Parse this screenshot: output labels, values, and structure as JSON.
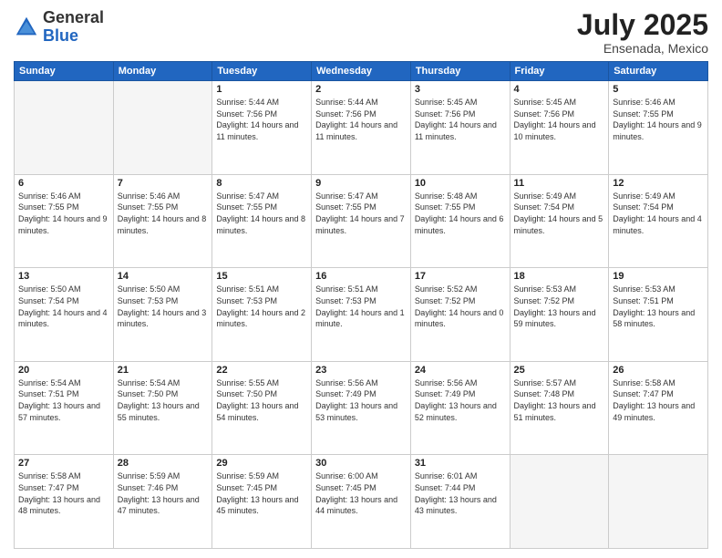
{
  "header": {
    "logo_general": "General",
    "logo_blue": "Blue",
    "month": "July 2025",
    "location": "Ensenada, Mexico"
  },
  "weekdays": [
    "Sunday",
    "Monday",
    "Tuesday",
    "Wednesday",
    "Thursday",
    "Friday",
    "Saturday"
  ],
  "weeks": [
    [
      {
        "day": "",
        "empty": true
      },
      {
        "day": "",
        "empty": true
      },
      {
        "day": "1",
        "sunrise": "Sunrise: 5:44 AM",
        "sunset": "Sunset: 7:56 PM",
        "daylight": "Daylight: 14 hours and 11 minutes."
      },
      {
        "day": "2",
        "sunrise": "Sunrise: 5:44 AM",
        "sunset": "Sunset: 7:56 PM",
        "daylight": "Daylight: 14 hours and 11 minutes."
      },
      {
        "day": "3",
        "sunrise": "Sunrise: 5:45 AM",
        "sunset": "Sunset: 7:56 PM",
        "daylight": "Daylight: 14 hours and 11 minutes."
      },
      {
        "day": "4",
        "sunrise": "Sunrise: 5:45 AM",
        "sunset": "Sunset: 7:56 PM",
        "daylight": "Daylight: 14 hours and 10 minutes."
      },
      {
        "day": "5",
        "sunrise": "Sunrise: 5:46 AM",
        "sunset": "Sunset: 7:55 PM",
        "daylight": "Daylight: 14 hours and 9 minutes."
      }
    ],
    [
      {
        "day": "6",
        "sunrise": "Sunrise: 5:46 AM",
        "sunset": "Sunset: 7:55 PM",
        "daylight": "Daylight: 14 hours and 9 minutes."
      },
      {
        "day": "7",
        "sunrise": "Sunrise: 5:46 AM",
        "sunset": "Sunset: 7:55 PM",
        "daylight": "Daylight: 14 hours and 8 minutes."
      },
      {
        "day": "8",
        "sunrise": "Sunrise: 5:47 AM",
        "sunset": "Sunset: 7:55 PM",
        "daylight": "Daylight: 14 hours and 8 minutes."
      },
      {
        "day": "9",
        "sunrise": "Sunrise: 5:47 AM",
        "sunset": "Sunset: 7:55 PM",
        "daylight": "Daylight: 14 hours and 7 minutes."
      },
      {
        "day": "10",
        "sunrise": "Sunrise: 5:48 AM",
        "sunset": "Sunset: 7:55 PM",
        "daylight": "Daylight: 14 hours and 6 minutes."
      },
      {
        "day": "11",
        "sunrise": "Sunrise: 5:49 AM",
        "sunset": "Sunset: 7:54 PM",
        "daylight": "Daylight: 14 hours and 5 minutes."
      },
      {
        "day": "12",
        "sunrise": "Sunrise: 5:49 AM",
        "sunset": "Sunset: 7:54 PM",
        "daylight": "Daylight: 14 hours and 4 minutes."
      }
    ],
    [
      {
        "day": "13",
        "sunrise": "Sunrise: 5:50 AM",
        "sunset": "Sunset: 7:54 PM",
        "daylight": "Daylight: 14 hours and 4 minutes."
      },
      {
        "day": "14",
        "sunrise": "Sunrise: 5:50 AM",
        "sunset": "Sunset: 7:53 PM",
        "daylight": "Daylight: 14 hours and 3 minutes."
      },
      {
        "day": "15",
        "sunrise": "Sunrise: 5:51 AM",
        "sunset": "Sunset: 7:53 PM",
        "daylight": "Daylight: 14 hours and 2 minutes."
      },
      {
        "day": "16",
        "sunrise": "Sunrise: 5:51 AM",
        "sunset": "Sunset: 7:53 PM",
        "daylight": "Daylight: 14 hours and 1 minute."
      },
      {
        "day": "17",
        "sunrise": "Sunrise: 5:52 AM",
        "sunset": "Sunset: 7:52 PM",
        "daylight": "Daylight: 14 hours and 0 minutes."
      },
      {
        "day": "18",
        "sunrise": "Sunrise: 5:53 AM",
        "sunset": "Sunset: 7:52 PM",
        "daylight": "Daylight: 13 hours and 59 minutes."
      },
      {
        "day": "19",
        "sunrise": "Sunrise: 5:53 AM",
        "sunset": "Sunset: 7:51 PM",
        "daylight": "Daylight: 13 hours and 58 minutes."
      }
    ],
    [
      {
        "day": "20",
        "sunrise": "Sunrise: 5:54 AM",
        "sunset": "Sunset: 7:51 PM",
        "daylight": "Daylight: 13 hours and 57 minutes."
      },
      {
        "day": "21",
        "sunrise": "Sunrise: 5:54 AM",
        "sunset": "Sunset: 7:50 PM",
        "daylight": "Daylight: 13 hours and 55 minutes."
      },
      {
        "day": "22",
        "sunrise": "Sunrise: 5:55 AM",
        "sunset": "Sunset: 7:50 PM",
        "daylight": "Daylight: 13 hours and 54 minutes."
      },
      {
        "day": "23",
        "sunrise": "Sunrise: 5:56 AM",
        "sunset": "Sunset: 7:49 PM",
        "daylight": "Daylight: 13 hours and 53 minutes."
      },
      {
        "day": "24",
        "sunrise": "Sunrise: 5:56 AM",
        "sunset": "Sunset: 7:49 PM",
        "daylight": "Daylight: 13 hours and 52 minutes."
      },
      {
        "day": "25",
        "sunrise": "Sunrise: 5:57 AM",
        "sunset": "Sunset: 7:48 PM",
        "daylight": "Daylight: 13 hours and 51 minutes."
      },
      {
        "day": "26",
        "sunrise": "Sunrise: 5:58 AM",
        "sunset": "Sunset: 7:47 PM",
        "daylight": "Daylight: 13 hours and 49 minutes."
      }
    ],
    [
      {
        "day": "27",
        "sunrise": "Sunrise: 5:58 AM",
        "sunset": "Sunset: 7:47 PM",
        "daylight": "Daylight: 13 hours and 48 minutes."
      },
      {
        "day": "28",
        "sunrise": "Sunrise: 5:59 AM",
        "sunset": "Sunset: 7:46 PM",
        "daylight": "Daylight: 13 hours and 47 minutes."
      },
      {
        "day": "29",
        "sunrise": "Sunrise: 5:59 AM",
        "sunset": "Sunset: 7:45 PM",
        "daylight": "Daylight: 13 hours and 45 minutes."
      },
      {
        "day": "30",
        "sunrise": "Sunrise: 6:00 AM",
        "sunset": "Sunset: 7:45 PM",
        "daylight": "Daylight: 13 hours and 44 minutes."
      },
      {
        "day": "31",
        "sunrise": "Sunrise: 6:01 AM",
        "sunset": "Sunset: 7:44 PM",
        "daylight": "Daylight: 13 hours and 43 minutes."
      },
      {
        "day": "",
        "empty": true
      },
      {
        "day": "",
        "empty": true
      }
    ]
  ]
}
